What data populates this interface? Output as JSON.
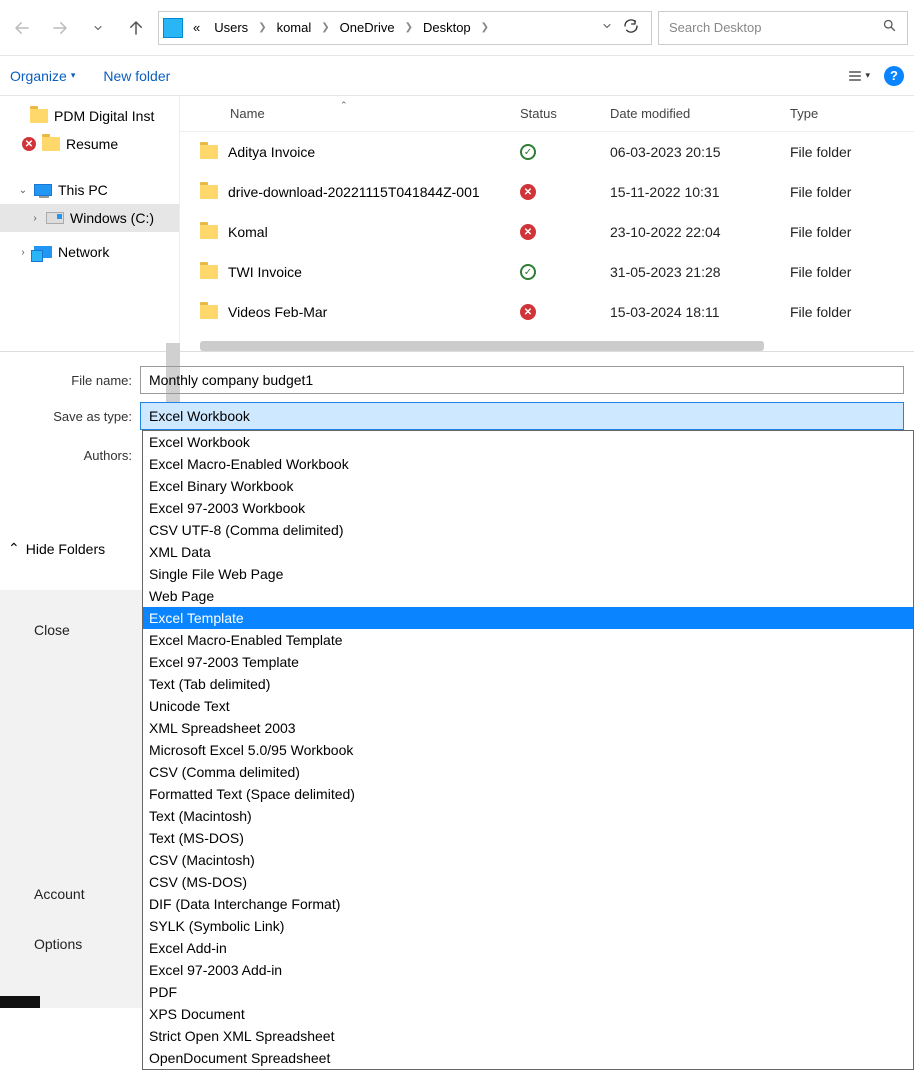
{
  "toolbar": {
    "address_prefix": "«",
    "breadcrumb": [
      "Users",
      "komal",
      "OneDrive",
      "Desktop"
    ],
    "search_placeholder": "Search Desktop"
  },
  "subbar": {
    "organize": "Organize",
    "new_folder": "New folder"
  },
  "sidebar": {
    "items": [
      {
        "label": "PDM Digital Inst",
        "icon": "folder"
      },
      {
        "label": "Resume",
        "icon": "folder",
        "error": true
      }
    ],
    "this_pc": "This PC",
    "windows_c": "Windows (C:)",
    "network": "Network"
  },
  "columns": {
    "name": "Name",
    "status": "Status",
    "date": "Date modified",
    "type": "Type"
  },
  "files": [
    {
      "name": "Aditya Invoice",
      "status": "ok",
      "date": "06-03-2023 20:15",
      "type": "File folder"
    },
    {
      "name": "drive-download-20221115T041844Z-001",
      "status": "err",
      "date": "15-11-2022 10:31",
      "type": "File folder"
    },
    {
      "name": "Komal",
      "status": "err",
      "date": "23-10-2022 22:04",
      "type": "File folder"
    },
    {
      "name": "TWI Invoice",
      "status": "ok",
      "date": "31-05-2023 21:28",
      "type": "File folder"
    },
    {
      "name": "Videos Feb-Mar",
      "status": "err",
      "date": "15-03-2024 18:11",
      "type": "File folder"
    }
  ],
  "save": {
    "file_name_label": "File name:",
    "file_name_value": "Monthly company budget1",
    "save_as_type_label": "Save as type:",
    "save_as_type_value": "Excel Workbook",
    "authors_label": "Authors:"
  },
  "type_options": [
    "Excel Workbook",
    "Excel Macro-Enabled Workbook",
    "Excel Binary Workbook",
    "Excel 97-2003 Workbook",
    "CSV UTF-8 (Comma delimited)",
    "XML Data",
    "Single File Web Page",
    "Web Page",
    "Excel Template",
    "Excel Macro-Enabled Template",
    "Excel 97-2003 Template",
    "Text (Tab delimited)",
    "Unicode Text",
    "XML Spreadsheet 2003",
    "Microsoft Excel 5.0/95 Workbook",
    "CSV (Comma delimited)",
    "Formatted Text (Space delimited)",
    "Text (Macintosh)",
    "Text (MS-DOS)",
    "CSV (Macintosh)",
    "CSV (MS-DOS)",
    "DIF (Data Interchange Format)",
    "SYLK (Symbolic Link)",
    "Excel Add-in",
    "Excel 97-2003 Add-in",
    "PDF",
    "XPS Document",
    "Strict Open XML Spreadsheet",
    "OpenDocument Spreadsheet"
  ],
  "highlighted_type_index": 8,
  "bottom": {
    "hide_folders": "Hide Folders",
    "close": "Close",
    "account": "Account",
    "options": "Options"
  }
}
